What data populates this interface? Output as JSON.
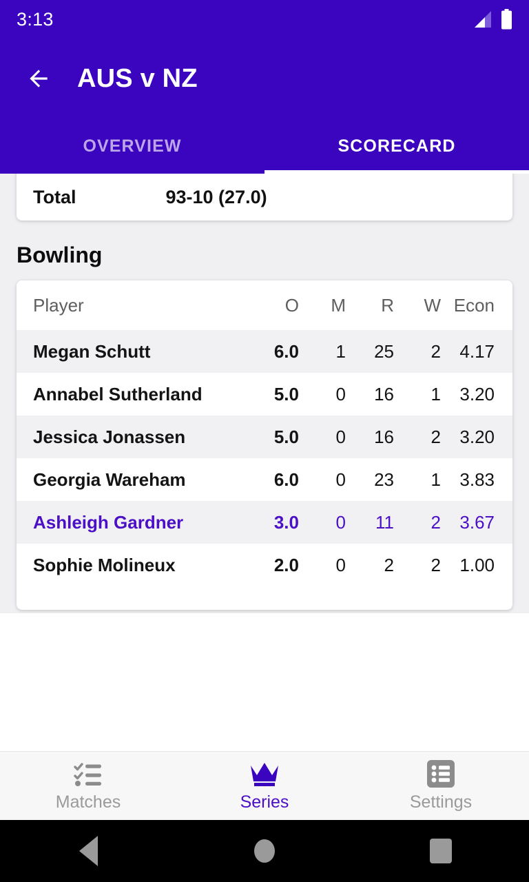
{
  "status_bar": {
    "time": "3:13",
    "signal_icon": "signal-cellular-icon",
    "battery_icon": "battery-full-icon"
  },
  "app_bar": {
    "back_icon": "arrow-left-icon",
    "title": "AUS v NZ"
  },
  "tabs": [
    {
      "label": "OVERVIEW",
      "active": false
    },
    {
      "label": "SCORECARD",
      "active": true
    }
  ],
  "total_card": {
    "label": "Total",
    "value": "93-10 (27.0)"
  },
  "bowling": {
    "section_title": "Bowling",
    "columns": [
      "Player",
      "O",
      "M",
      "R",
      "W",
      "Econ"
    ],
    "rows": [
      {
        "player": "Megan Schutt",
        "o": "6.0",
        "m": "1",
        "r": "25",
        "w": "2",
        "econ": "4.17",
        "highlighted": false
      },
      {
        "player": "Annabel Sutherland",
        "o": "5.0",
        "m": "0",
        "r": "16",
        "w": "1",
        "econ": "3.20",
        "highlighted": false
      },
      {
        "player": "Jessica Jonassen",
        "o": "5.0",
        "m": "0",
        "r": "16",
        "w": "2",
        "econ": "3.20",
        "highlighted": false
      },
      {
        "player": "Georgia Wareham",
        "o": "6.0",
        "m": "0",
        "r": "23",
        "w": "1",
        "econ": "3.83",
        "highlighted": false
      },
      {
        "player": "Ashleigh Gardner",
        "o": "3.0",
        "m": "0",
        "r": "11",
        "w": "2",
        "econ": "3.67",
        "highlighted": true
      },
      {
        "player": "Sophie Molineux",
        "o": "2.0",
        "m": "0",
        "r": "2",
        "w": "2",
        "econ": "1.00",
        "highlighted": false
      }
    ]
  },
  "bottom_nav": [
    {
      "label": "Matches",
      "icon": "playlist-check-icon",
      "active": false
    },
    {
      "label": "Series",
      "icon": "crown-icon",
      "active": true
    },
    {
      "label": "Settings",
      "icon": "list-box-icon",
      "active": false
    }
  ],
  "system_nav": [
    {
      "icon": "android-back-icon"
    },
    {
      "icon": "android-home-icon"
    },
    {
      "icon": "android-recents-icon"
    }
  ],
  "colors": {
    "primary": "#3B04BE",
    "accent": "#4B10C6",
    "page_background": "#F0F0F3",
    "card_background": "#FFFFFF",
    "row_alt": "#F1F1F4",
    "inactive_tab_text": "#BCA5E8",
    "muted_text": "#9A9A9A"
  }
}
